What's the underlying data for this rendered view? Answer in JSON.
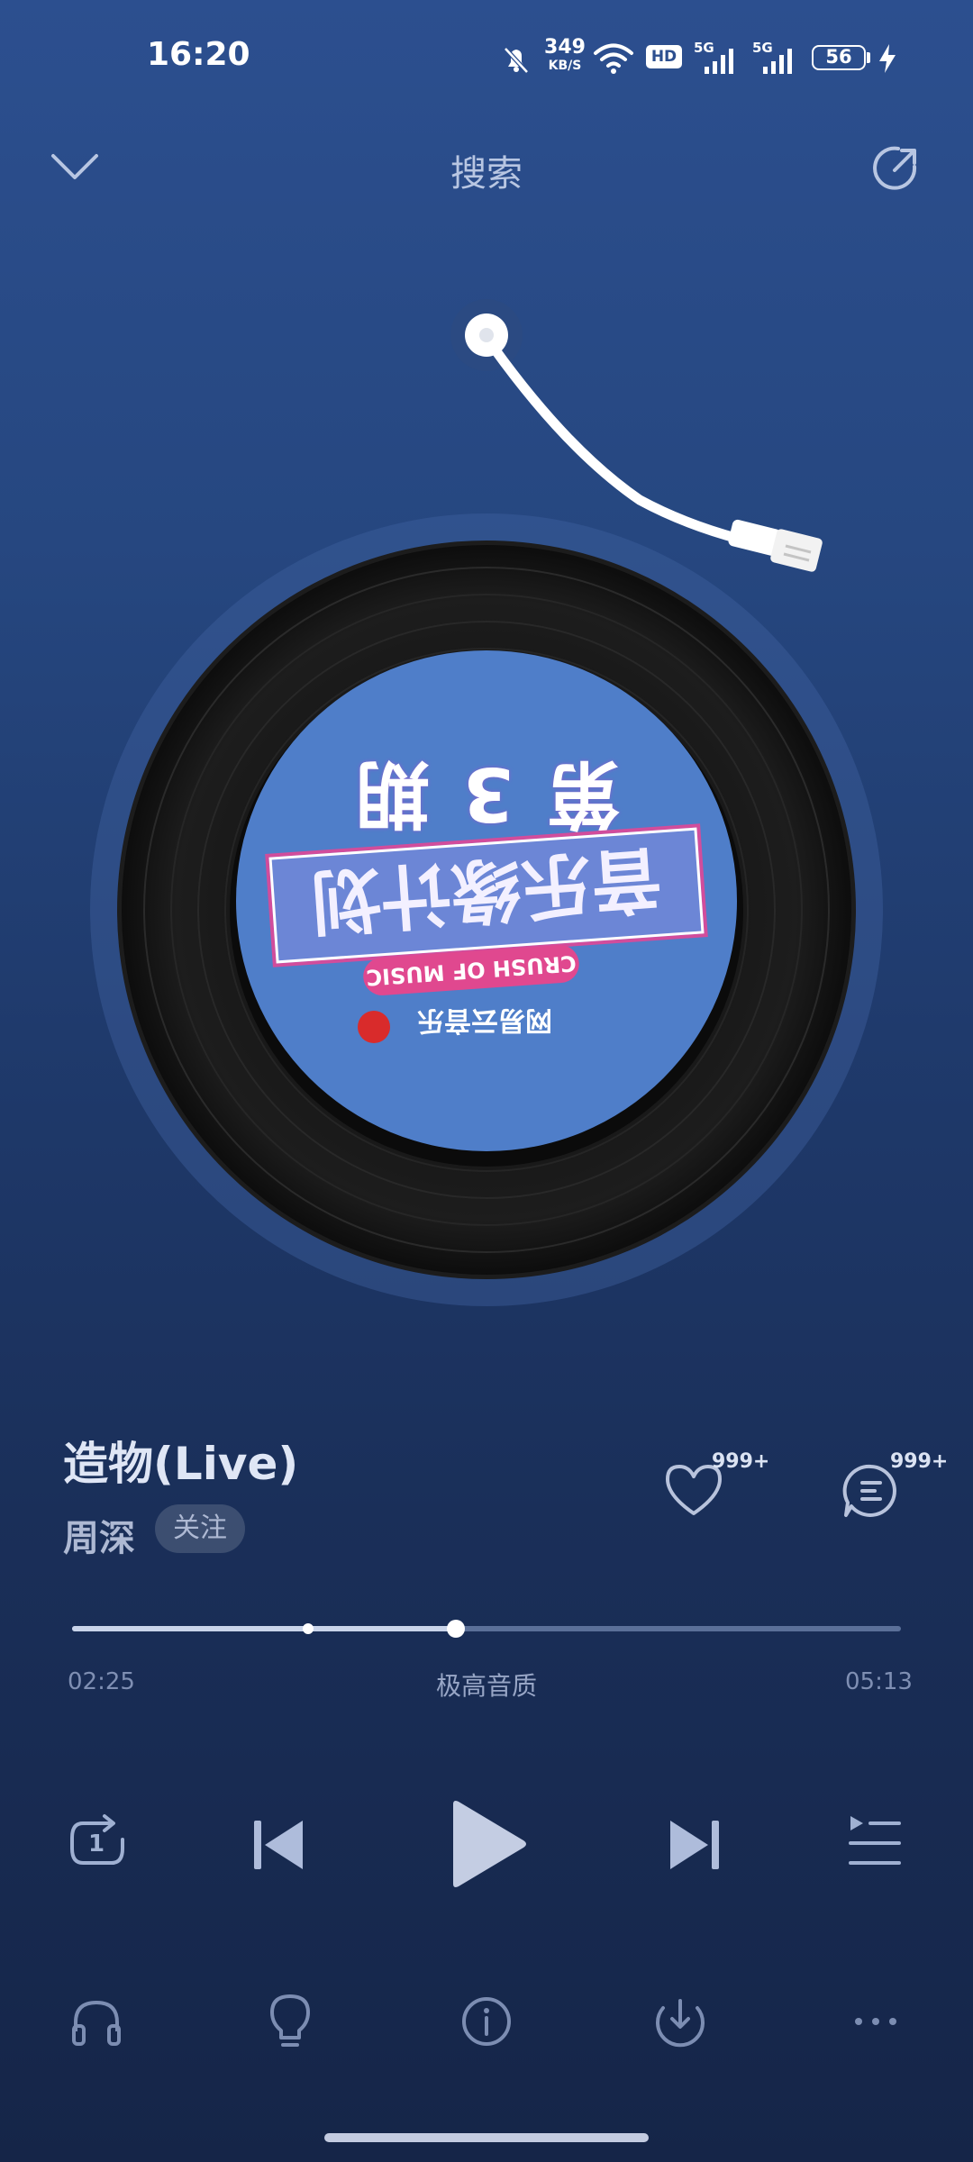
{
  "status_bar": {
    "time": "16:20",
    "network_speed_value": "349",
    "network_speed_unit": "KB/S",
    "hd_badge": "HD",
    "signal1_label": "5G",
    "signal2_label": "5G",
    "battery_level": "56",
    "icons": [
      "mute-bell-icon",
      "wifi-icon",
      "hd-icon",
      "signal-icon",
      "battery-icon",
      "charging-icon"
    ]
  },
  "header": {
    "title": "搜索",
    "left_icon": "chevron-down-icon",
    "right_icon": "share-icon"
  },
  "album_art": {
    "label_lines": [
      "第 3 期",
      "音乐缘计划",
      "CRUSH OF MUSIC",
      "网易云音乐"
    ]
  },
  "song": {
    "title": "造物(Live)",
    "artist": "周深",
    "follow_label": "关注",
    "like_count": "999+",
    "comment_count": "999+"
  },
  "progress": {
    "elapsed": "02:25",
    "total": "05:13",
    "quality": "极高音质",
    "played_fraction": 0.463,
    "mark_fraction": 0.285
  },
  "controls": {
    "repeat_badge": "1",
    "icons": [
      "repeat-one-icon",
      "previous-icon",
      "play-icon",
      "next-icon",
      "playlist-icon"
    ]
  },
  "bottom_bar": {
    "icons": [
      "headphones-icon",
      "lightbulb-icon",
      "info-icon",
      "download-icon",
      "more-icon"
    ]
  },
  "colors": {
    "background_top": "#2c4f8f",
    "background_bottom": "#152548",
    "label_blue": "#4f7ec9",
    "label_pink": "#e0488f"
  }
}
